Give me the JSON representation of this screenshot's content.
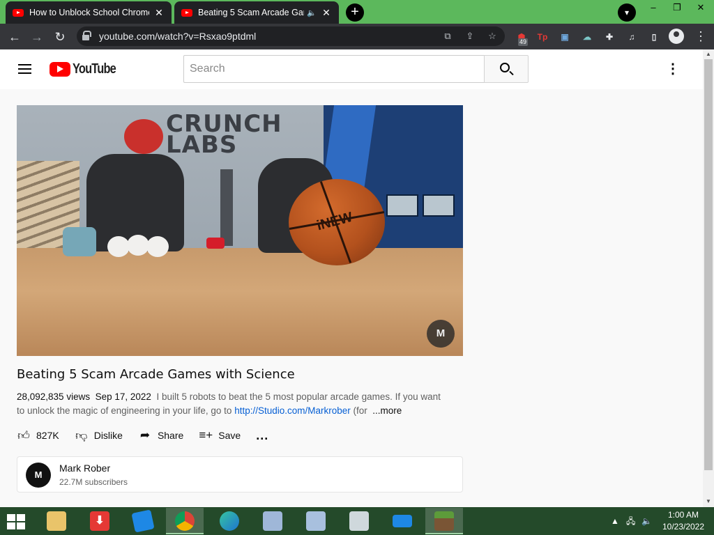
{
  "browser": {
    "tabs": [
      {
        "title": "How to Unblock School Chromeb",
        "active": false
      },
      {
        "title": "Beating 5 Scam Arcade Gam",
        "active": true
      }
    ],
    "new_tab_label": "+",
    "url": "youtube.com/watch?v=Rsxao9ptdml",
    "extension_badge": "49",
    "ext_tp_label": "Tp",
    "window_controls": [
      "–",
      "❐",
      "✕"
    ]
  },
  "youtube": {
    "logo_text": "YouTube",
    "search": {
      "placeholder": "Search",
      "value": ""
    },
    "video": {
      "title": "Beating 5 Scam Arcade Games with Science",
      "views": "28,092,835 views",
      "date": "Sep 17, 2022",
      "description_1": "I built 5 robots to beat the 5 most popular arcade games.  If you want to unlock the magic of engineering in your life, go to ",
      "description_link": "http://Studio.com/Markrober",
      "description_2": " (for",
      "more_label": "...more",
      "thumbnail_text": "CRUNCH LABS",
      "ball_text": "iNEW"
    },
    "actions": {
      "like_count": "827K",
      "dislike_label": "Dislike",
      "share_label": "Share",
      "save_label": "Save",
      "more_dots": "..."
    },
    "channel": {
      "name": "Mark Rober",
      "subscribers": "22.7M subscribers"
    }
  },
  "taskbar": {
    "time": "1:00 AM",
    "date": "10/23/2022"
  },
  "colors": {
    "tabstrip": "#5cb85c",
    "taskbar": "#244a2a",
    "youtube_red": "#ff0000",
    "link": "#065fd4"
  }
}
